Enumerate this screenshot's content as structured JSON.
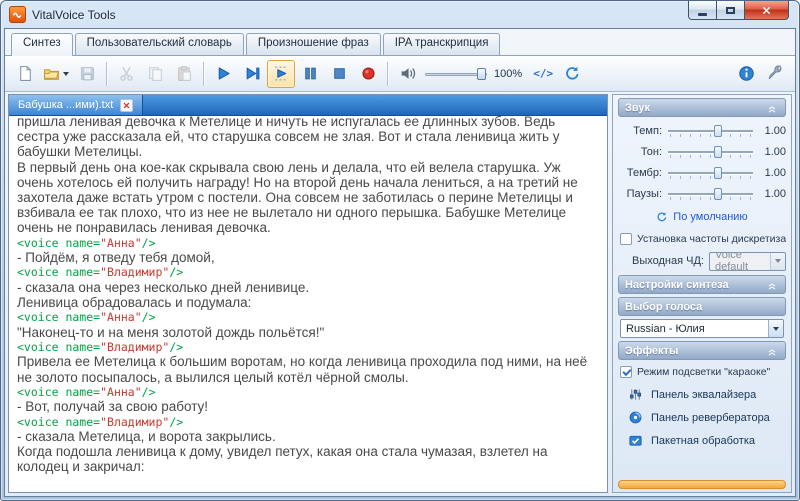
{
  "window": {
    "title": "VitalVoice Tools"
  },
  "colors": {
    "accent_blue": "#2e82d8",
    "doc_tab_bar_blue": "#2a6fc4",
    "tag_green": "#00a346",
    "tag_name_red": "#c43b2e",
    "highlight_orange": "#f1a93b"
  },
  "tabs": [
    {
      "name": "synthesis",
      "label": "Синтез",
      "active": true
    },
    {
      "name": "user-dictionary",
      "label": "Пользовательский словарь",
      "active": false
    },
    {
      "name": "phrase-pronunciation",
      "label": "Произношение фраз",
      "active": false
    },
    {
      "name": "ipa-transcription",
      "label": "IPA транскрипция",
      "active": false
    }
  ],
  "toolbar": {
    "buttons": [
      {
        "name": "new-file-button",
        "icon": "new-file-icon"
      },
      {
        "name": "open-file-button",
        "icon": "open-folder-icon",
        "dropdown": true
      },
      {
        "name": "save-button",
        "icon": "save-icon",
        "disabled": true
      },
      {
        "type": "sep"
      },
      {
        "name": "cut-button",
        "icon": "scissors-icon",
        "disabled": true
      },
      {
        "name": "copy-button",
        "icon": "copy-icon",
        "disabled": true
      },
      {
        "name": "paste-button",
        "icon": "paste-icon",
        "disabled": true
      },
      {
        "type": "sep"
      },
      {
        "name": "play-button",
        "icon": "play-icon"
      },
      {
        "name": "play-from-cursor-button",
        "icon": "play-from-cursor-icon"
      },
      {
        "name": "play-selection-button",
        "icon": "play-selection-icon",
        "active": true
      },
      {
        "name": "pause-button",
        "icon": "pause-icon"
      },
      {
        "name": "stop-button",
        "icon": "stop-icon"
      },
      {
        "name": "record-button",
        "icon": "record-icon"
      },
      {
        "type": "sep"
      },
      {
        "name": "volume-speaker",
        "icon": "speaker-icon",
        "flat": true
      },
      {
        "type": "volume-slider"
      },
      {
        "type": "label",
        "name": "volume-value",
        "text": "100%"
      },
      {
        "name": "xml-button",
        "icon": "xml-icon"
      },
      {
        "name": "refresh-button",
        "icon": "refresh-icon"
      }
    ],
    "right_buttons": [
      {
        "name": "info-button",
        "icon": "info-icon"
      },
      {
        "name": "settings-button",
        "icon": "wrench-icon"
      }
    ]
  },
  "document": {
    "tab_label": "Бабушка ...ими).txt",
    "content": [
      {
        "type": "text",
        "text": "пришла ленивая девочка к Метелице и ничуть не испугалась ее длинных зубов. Ведь сестра уже рассказала ей, что старушка совсем не злая. Вот и стала ленивица жить у бабушки Метелицы."
      },
      {
        "type": "text",
        "text": "В первый день она кое-как скрывала свою лень и делала, что ей велела старушка. Уж очень хотелось ей получить награду! Но на второй день начала лениться, а на третий не захотела даже встать утром с постели. Она совсем не заботилась о перине Метелицы и взбивала ее так плохо, что из нее не вылетало ни одного перышка. Бабушке Метелице очень не понравилась ленивая девочка."
      },
      {
        "type": "tag",
        "name": "Анна"
      },
      {
        "type": "text",
        "text": "- Пойдём, я отведу тебя домой,"
      },
      {
        "type": "tag",
        "name": "Владимир"
      },
      {
        "type": "text",
        "text": "- сказала она через несколько дней ленивице."
      },
      {
        "type": "text",
        "text": "Ленивица обрадовалась и подумала:"
      },
      {
        "type": "tag",
        "name": "Анна"
      },
      {
        "type": "text",
        "text": " \"Наконец-то и на меня золотой дождь польётся!\""
      },
      {
        "type": "tag",
        "name": "Владимир"
      },
      {
        "type": "text",
        "text": "Привела ее Метелица к большим воротам, но когда ленивица проходила под ними, на неё не золото посыпалось, а вылился целый котёл чёрной смолы."
      },
      {
        "type": "tag",
        "name": "Анна"
      },
      {
        "type": "text",
        "text": "- Вот, получай за свою работу!"
      },
      {
        "type": "tag",
        "name": "Владимир"
      },
      {
        "type": "text",
        "text": "- сказала Метелица, и ворота закрылись."
      },
      {
        "type": "text",
        "text": "Когда подошла ленивица к дому, увидел петух, какая она стала чумазая, взлетел на колодец и закричал:"
      }
    ]
  },
  "panels": {
    "sound": {
      "title": "Звук",
      "sliders": [
        {
          "name": "tempo",
          "label": "Темп:",
          "value": "1.00"
        },
        {
          "name": "tone",
          "label": "Тон:",
          "value": "1.00"
        },
        {
          "name": "timbre",
          "label": "Тембр:",
          "value": "1.00"
        },
        {
          "name": "pauses",
          "label": "Паузы:",
          "value": "1.00"
        }
      ],
      "default_link": "По умолчанию",
      "samplerate_label": "Установка частоты дискретизации",
      "samplerate_checked": false,
      "output_label": "Выходная ЧД:",
      "output_value": "Voice default"
    },
    "synthesis": {
      "title": "Настройки синтеза",
      "voice_header": "Выбор голоса",
      "voice_value": "Russian - Юлия"
    },
    "effects": {
      "title": "Эффекты",
      "karaoke_label": "Режим подсветки \"караоке\"",
      "karaoke_checked": true,
      "items": [
        {
          "name": "equalizer-panel",
          "icon": "equalizer-icon",
          "label": "Панель эквалайзера"
        },
        {
          "name": "reverb-panel",
          "icon": "reverb-icon",
          "label": "Панель ревербератора"
        },
        {
          "name": "batch-processing",
          "icon": "batch-icon",
          "label": "Пакетная обработка"
        }
      ]
    }
  }
}
